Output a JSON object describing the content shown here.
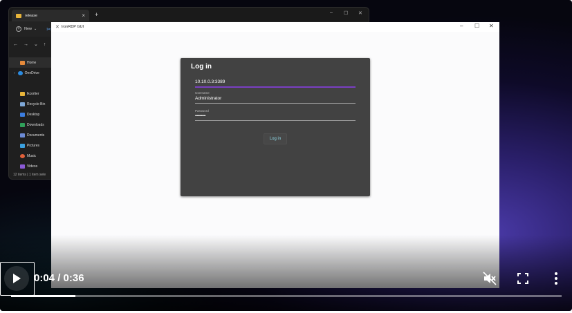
{
  "explorer": {
    "tab_title": "release",
    "new_label": "New",
    "sidebar": [
      {
        "label": "Home",
        "color": "#e58a3b"
      },
      {
        "label": "OneDrive",
        "color": "#2b8be0"
      },
      {
        "label": "lkcortier",
        "color": "#e7b43a"
      },
      {
        "label": "Recycle Bin",
        "color": "#7fa8d8"
      },
      {
        "label": "Desktop",
        "color": "#3b7de0"
      },
      {
        "label": "Downloads",
        "color": "#2fa05a"
      },
      {
        "label": "Documents",
        "color": "#6c8bd6"
      },
      {
        "label": "Pictures",
        "color": "#3aa0e0"
      },
      {
        "label": "Music",
        "color": "#e0603a"
      },
      {
        "label": "Videos",
        "color": "#8a5ad6"
      }
    ],
    "status": "12 items  |  1 item sele"
  },
  "app": {
    "title": "IronRDP GUI",
    "dialog": {
      "heading": "Log in",
      "host_value": "10.10.0.3:3389",
      "username_label": "Username",
      "username_value": "Administrator",
      "password_label": "Password",
      "password_value": "••••••••••••",
      "button_label": "Log in"
    }
  },
  "player": {
    "time_text": "0:04 / 0:36",
    "progress_fraction": 0.117,
    "colors": {
      "accent": "#ffffff",
      "focus_underline": "#7b3fc4",
      "button_text": "#8fd9e6"
    }
  }
}
